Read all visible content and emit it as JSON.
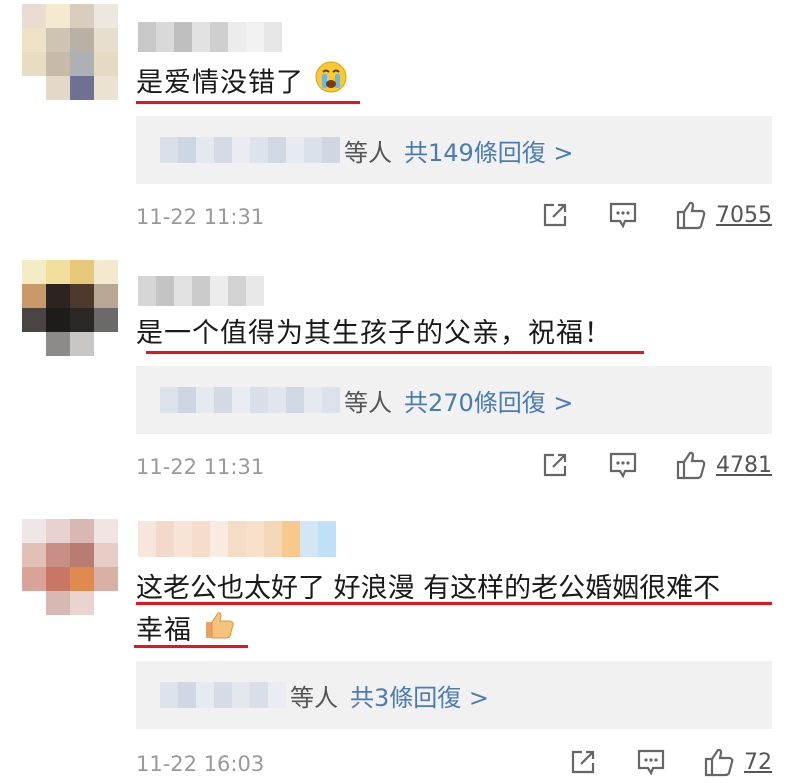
{
  "comments": [
    {
      "text": "是爱情没错了",
      "emoji": "crying-face",
      "reply_suffix": "等人",
      "reply_link": "共149條回復 >",
      "time": "11-22 11:31",
      "likes": "7055"
    },
    {
      "text": "是一个值得为其生孩子的父亲，祝福！",
      "emoji": "",
      "reply_suffix": "等人",
      "reply_link": "共270條回復 >",
      "time": "11-22 11:31",
      "likes": "4781"
    },
    {
      "text_line1": "这老公也太好了 好浪漫 有这样的老公婚姻很难不",
      "text_line2": "幸福",
      "emoji": "thumbs-up",
      "reply_suffix": "等人",
      "reply_link": "共3條回復 >",
      "time": "11-22 16:03",
      "likes": "72"
    }
  ],
  "icons": {
    "share": "share-icon",
    "comment": "comment-icon",
    "like": "thumbs-up-icon"
  },
  "colors": {
    "underline": "#e8141c",
    "reply_link": "#4a7bb5",
    "reply_bg": "#f1f1f1",
    "meta": "#999999"
  }
}
